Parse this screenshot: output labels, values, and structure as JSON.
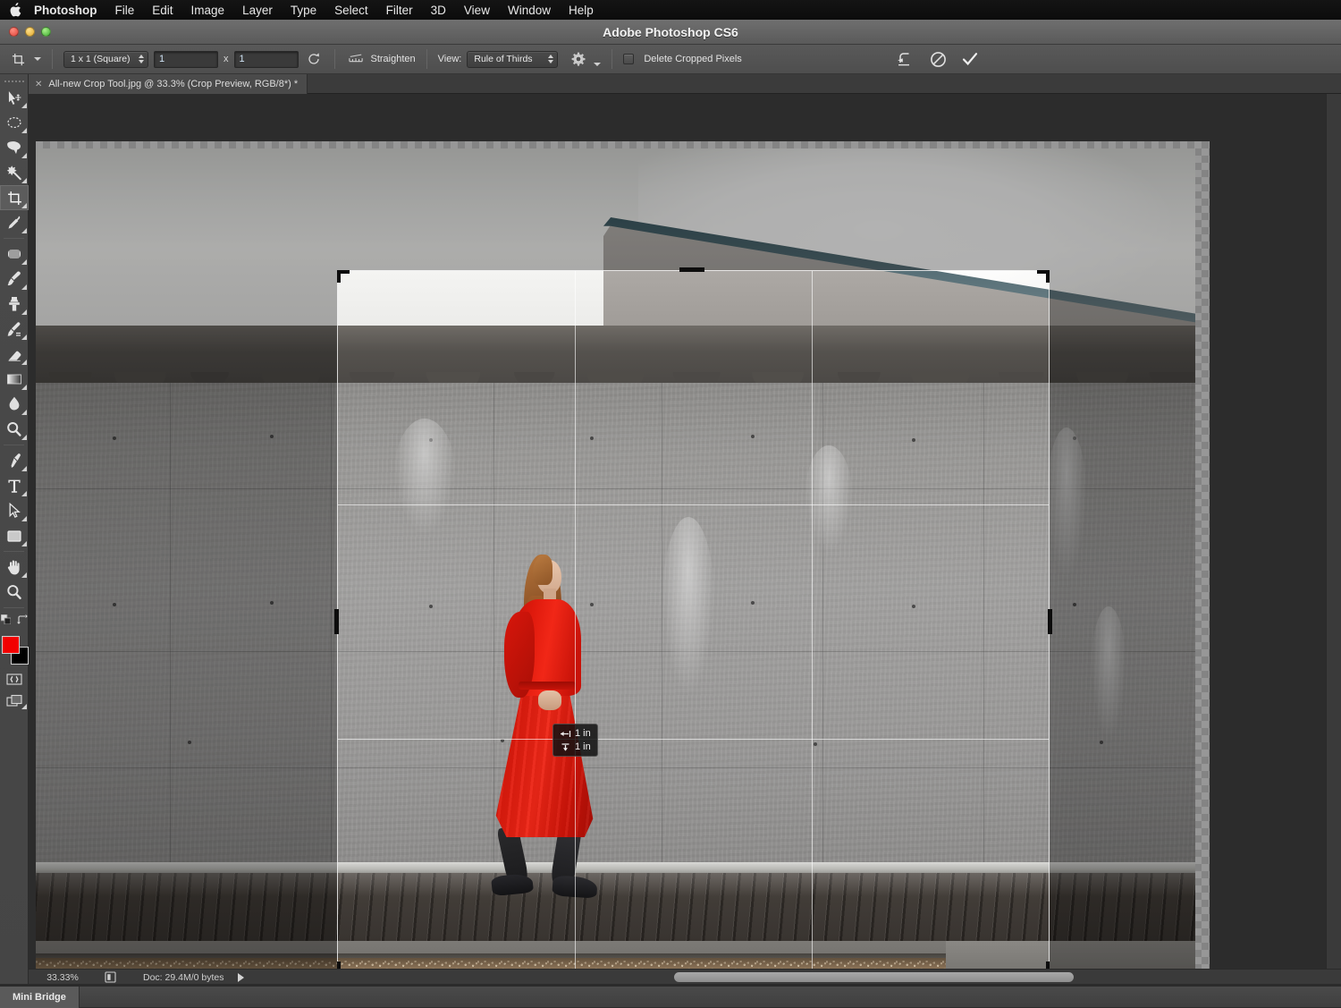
{
  "menubar": {
    "apple_icon": "apple-logo-icon",
    "items": [
      {
        "label": "Photoshop",
        "bold": true
      },
      {
        "label": "File",
        "bold": false
      },
      {
        "label": "Edit",
        "bold": false
      },
      {
        "label": "Image",
        "bold": false
      },
      {
        "label": "Layer",
        "bold": false
      },
      {
        "label": "Type",
        "bold": false
      },
      {
        "label": "Select",
        "bold": false
      },
      {
        "label": "Filter",
        "bold": false
      },
      {
        "label": "3D",
        "bold": false
      },
      {
        "label": "View",
        "bold": false
      },
      {
        "label": "Window",
        "bold": false
      },
      {
        "label": "Help",
        "bold": false
      }
    ]
  },
  "titlebar": {
    "title": "Adobe Photoshop CS6",
    "close_label": "close-button",
    "minimize_label": "minimize-button",
    "zoom_label": "zoom-button"
  },
  "options_bar": {
    "tool_icon": "crop-tool-icon",
    "ratio_preset": "1 x 1 (Square)",
    "width_value": "1",
    "height_value": "1",
    "multiply_symbol": "x",
    "swap_icon": "swap-width-height-icon",
    "straighten_icon": "straighten-icon",
    "straighten_label": "Straighten",
    "view_label": "View:",
    "overlay_preset": "Rule of Thirds",
    "settings_icon": "gear-icon",
    "delete_cropped_label": "Delete Cropped Pixels",
    "delete_cropped_checked": false,
    "reset_icon": "reset-icon",
    "cancel_icon": "cancel-icon",
    "commit_icon": "commit-checkmark-icon"
  },
  "document_tab": {
    "close_icon": "tab-close-icon",
    "title": "All-new Crop Tool.jpg @ 33.3% (Crop Preview, RGB/8*) *"
  },
  "tools": [
    {
      "name": "move-tool",
      "has_flyout": true,
      "selected": false
    },
    {
      "name": "marquee-tool",
      "has_flyout": true,
      "selected": false
    },
    {
      "name": "lasso-tool",
      "has_flyout": true,
      "selected": false
    },
    {
      "name": "magic-wand-tool",
      "has_flyout": true,
      "selected": false
    },
    {
      "name": "crop-tool",
      "has_flyout": true,
      "selected": true
    },
    {
      "name": "eyedropper-tool",
      "has_flyout": true,
      "selected": false
    },
    {
      "name": "healing-brush-tool",
      "has_flyout": true,
      "selected": false
    },
    {
      "name": "brush-tool",
      "has_flyout": true,
      "selected": false
    },
    {
      "name": "clone-stamp-tool",
      "has_flyout": true,
      "selected": false
    },
    {
      "name": "history-brush-tool",
      "has_flyout": true,
      "selected": false
    },
    {
      "name": "eraser-tool",
      "has_flyout": true,
      "selected": false
    },
    {
      "name": "gradient-tool",
      "has_flyout": true,
      "selected": false
    },
    {
      "name": "blur-tool",
      "has_flyout": true,
      "selected": false
    },
    {
      "name": "dodge-tool",
      "has_flyout": true,
      "selected": false
    },
    {
      "name": "pen-tool",
      "has_flyout": true,
      "selected": false
    },
    {
      "name": "type-tool",
      "has_flyout": true,
      "selected": false
    },
    {
      "name": "path-selection-tool",
      "has_flyout": true,
      "selected": false
    },
    {
      "name": "rectangle-shape-tool",
      "has_flyout": true,
      "selected": false
    },
    {
      "name": "hand-tool",
      "has_flyout": true,
      "selected": false
    },
    {
      "name": "zoom-tool",
      "has_flyout": false,
      "selected": false
    }
  ],
  "color_swatches": {
    "foreground": "#f20000",
    "background": "#000000",
    "default_colors_icon": "default-colors-icon",
    "swap_colors_icon": "swap-colors-icon",
    "quick_mask_icon": "quick-mask-icon",
    "screen_mode_icon": "screen-mode-icon"
  },
  "crop_overlay": {
    "size_width": "1 in",
    "size_height": "1 in",
    "width_icon": "width-arrow-icon",
    "height_icon": "height-arrow-icon",
    "overlay_type": "Rule of Thirds"
  },
  "status_bar": {
    "zoom_level": "33.33%",
    "thumbnail_icon": "document-proxy-icon",
    "doc_info": "Doc: 29.4M/0 bytes",
    "expand_icon": "status-expand-arrow-icon"
  },
  "bottom_bar": {
    "mini_bridge_label": "Mini Bridge"
  }
}
